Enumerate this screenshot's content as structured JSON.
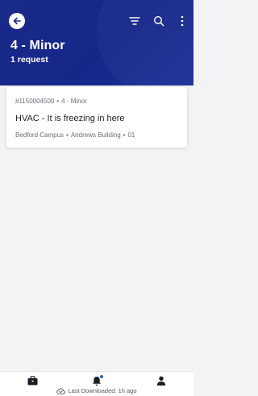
{
  "header": {
    "title": "4 - Minor",
    "subtitle": "1 request",
    "back_icon": "arrow-left-icon",
    "actions": [
      "filter-icon",
      "search-icon",
      "more-vertical-icon"
    ],
    "background_color": "#18298c"
  },
  "requests": [
    {
      "id": "#1150004500",
      "priority": "4 - Minor",
      "title": "HVAC - It is freezing in here",
      "campus": "Bedford Campus",
      "building": "Andrews Building",
      "room": "01"
    }
  ],
  "separator": "•",
  "bottom_nav": {
    "items": [
      "briefcase-icon",
      "bell-icon",
      "person-icon"
    ],
    "notification_dot_color": "#2a5bd7",
    "status_text": "Last Downloaded: 1h ago",
    "status_icon": "cloud-check-icon"
  }
}
